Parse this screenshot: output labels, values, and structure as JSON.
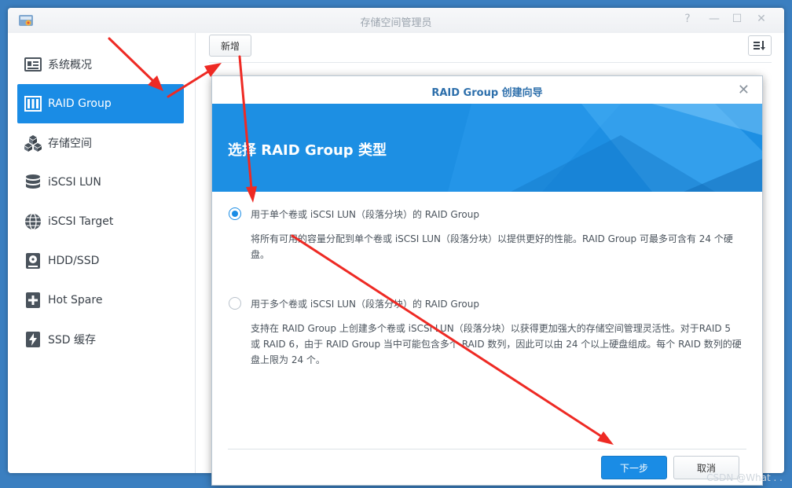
{
  "window": {
    "title": "存储空间管理员"
  },
  "sidebar": {
    "items": [
      {
        "label": "系统概况",
        "icon": "overview-icon",
        "active": false
      },
      {
        "label": "RAID Group",
        "icon": "raid-icon",
        "active": true
      },
      {
        "label": "存储空间",
        "icon": "storage-cubes-icon",
        "active": false
      },
      {
        "label": "iSCSI LUN",
        "icon": "database-icon",
        "active": false
      },
      {
        "label": "iSCSI Target",
        "icon": "globe-icon",
        "active": false
      },
      {
        "label": "HDD/SSD",
        "icon": "disk-icon",
        "active": false
      },
      {
        "label": "Hot Spare",
        "icon": "plus-box-icon",
        "active": false
      },
      {
        "label": "SSD 缓存",
        "icon": "flash-icon",
        "active": false
      }
    ]
  },
  "toolbar": {
    "add_label": "新增"
  },
  "dialog": {
    "title": "RAID Group 创建向导",
    "heading": "选择 RAID Group 类型",
    "options": [
      {
        "label": "用于单个卷或 iSCSI LUN（段落分块）的 RAID Group",
        "desc": "将所有可用的容量分配到单个卷或 iSCSI LUN（段落分块）以提供更好的性能。RAID Group 可最多可含有 24 个硬盘。",
        "checked": true
      },
      {
        "label": "用于多个卷或 iSCSI LUN（段落分块）的 RAID Group",
        "desc": "支持在 RAID Group 上创建多个卷或 iSCSI LUN（段落分块）以获得更加强大的存储空间管理灵活性。对于RAID 5 或 RAID 6，由于 RAID Group 当中可能包含多个 RAID 数列，因此可以由 24 个以上硬盘组成。每个 RAID 数列的硬盘上限为 24 个。",
        "checked": false
      }
    ],
    "next_label": "下一步",
    "cancel_label": "取消"
  },
  "watermark": "CSDN @What . .",
  "colors": {
    "accent": "#1a8ce5",
    "annotation_arrow": "#ee2a24"
  }
}
